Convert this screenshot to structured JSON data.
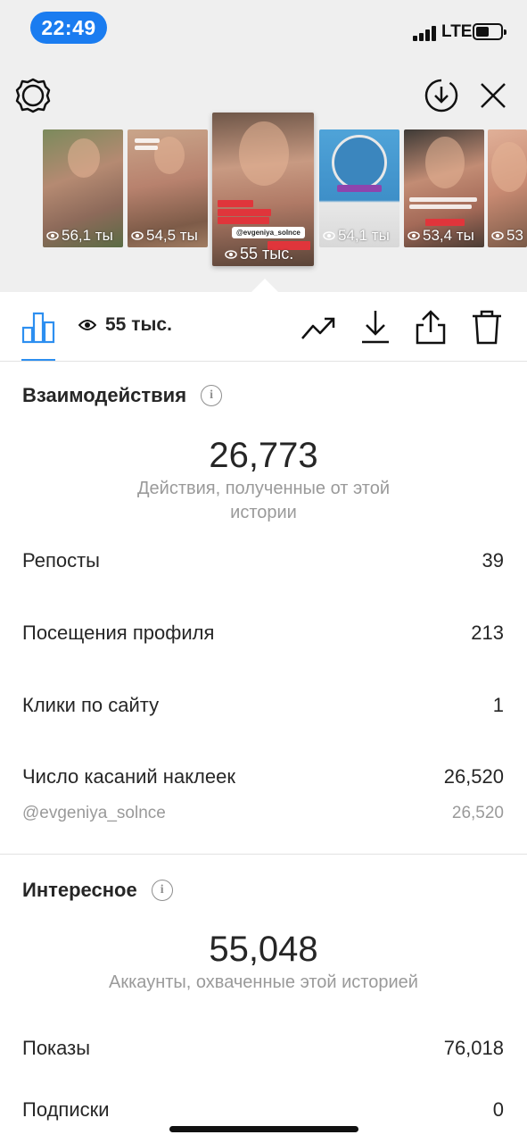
{
  "status_bar": {
    "time": "22:49",
    "network": "LTE"
  },
  "thumbnails": [
    {
      "views": "56,1 ты"
    },
    {
      "views": "54,5 ты"
    },
    {
      "views": "55 тыс.",
      "handle": "@evgeniya_solnce",
      "selected": true
    },
    {
      "views": "54,1 ты"
    },
    {
      "views": "53,4 ты"
    },
    {
      "views": "53"
    }
  ],
  "toolbar": {
    "views_label": "55 тыс."
  },
  "interactions": {
    "title": "Взаимодействия",
    "total": "26,773",
    "total_caption": "Действия, полученные от этой истории",
    "rows": [
      {
        "label": "Репосты",
        "value": "39"
      },
      {
        "label": "Посещения профиля",
        "value": "213"
      },
      {
        "label": "Клики по сайту",
        "value": "1"
      },
      {
        "label": "Число касаний наклеек",
        "value": "26,520"
      }
    ],
    "sticker_detail": {
      "label": "@evgeniya_solnce",
      "value": "26,520"
    }
  },
  "discovery": {
    "title": "Интересное",
    "total": "55,048",
    "total_caption": "Аккаунты, охваченные этой историей",
    "rows": [
      {
        "label": "Показы",
        "value": "76,018"
      },
      {
        "label": "Подписки",
        "value": "0"
      }
    ]
  },
  "colors": {
    "accent": "#2d8ff0",
    "time_pill": "#1a7cf0",
    "text": "#262626",
    "muted": "#9a9a9a"
  },
  "icons": [
    "gear-icon",
    "download-circle-icon",
    "close-icon",
    "bar-chart-icon",
    "eye-icon",
    "trend-icon",
    "download-icon",
    "share-icon",
    "trash-icon",
    "info-icon"
  ]
}
